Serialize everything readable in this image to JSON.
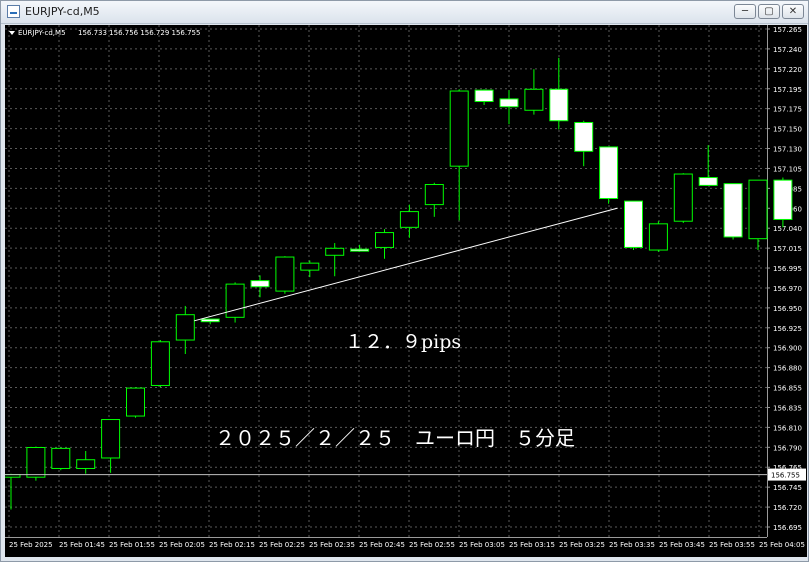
{
  "window": {
    "title": "EURJPY-cd,M5"
  },
  "buttons": {
    "minimize": "─",
    "restore": "▢",
    "close": "✕"
  },
  "header": {
    "symbol": "EURJPY-cd,M5",
    "quotes": "156.733 156.756 156.729 156.755"
  },
  "annotations": {
    "pips": "１２．９pips",
    "caption": "２０２５／２／２５　ユーロ円　５分足"
  },
  "colors": {
    "background": "#000000",
    "grid": "#5a5a5a",
    "bull": "#00ff00",
    "bear_fill": "#ffffff",
    "text": "#ffffff"
  },
  "chart_data": {
    "type": "candlestick",
    "ylim": [
      156.695,
      157.265
    ],
    "yticks": [
      "157.265",
      "157.240",
      "157.220",
      "157.195",
      "157.175",
      "157.150",
      "157.130",
      "157.105",
      "157.085",
      "157.060",
      "157.040",
      "157.015",
      "156.995",
      "156.970",
      "156.950",
      "156.925",
      "156.900",
      "156.880",
      "156.855",
      "156.835",
      "156.810",
      "156.790",
      "156.765",
      "156.745",
      "156.720",
      "156.695"
    ],
    "xticks": [
      "25 Feb 2025",
      "25 Feb 01:45",
      "25 Feb 01:55",
      "25 Feb 02:05",
      "25 Feb 02:15",
      "25 Feb 02:25",
      "25 Feb 02:35",
      "25 Feb 02:45",
      "25 Feb 02:55",
      "25 Feb 03:05",
      "25 Feb 03:15",
      "25 Feb 03:25",
      "25 Feb 03:35",
      "25 Feb 03:45",
      "25 Feb 03:55",
      "25 Feb 04:05"
    ],
    "current_price": "156.755",
    "current_price_value": 156.755,
    "candles": [
      {
        "o": 156.752,
        "h": 156.756,
        "l": 156.715,
        "c": 156.755
      },
      {
        "o": 156.752,
        "h": 156.787,
        "l": 156.748,
        "c": 156.786
      },
      {
        "o": 156.762,
        "h": 156.786,
        "l": 156.76,
        "c": 156.785
      },
      {
        "o": 156.762,
        "h": 156.782,
        "l": 156.756,
        "c": 156.772
      },
      {
        "o": 156.774,
        "h": 156.818,
        "l": 156.757,
        "c": 156.818
      },
      {
        "o": 156.822,
        "h": 156.855,
        "l": 156.82,
        "c": 156.854
      },
      {
        "o": 156.857,
        "h": 156.909,
        "l": 156.855,
        "c": 156.907
      },
      {
        "o": 156.909,
        "h": 156.948,
        "l": 156.893,
        "c": 156.938
      },
      {
        "o": 156.933,
        "h": 156.927,
        "l": 156.927,
        "c": 156.93
      },
      {
        "o": 156.935,
        "h": 156.975,
        "l": 156.929,
        "c": 156.973
      },
      {
        "o": 156.977,
        "h": 156.983,
        "l": 156.958,
        "c": 156.97
      },
      {
        "o": 156.965,
        "h": 157.005,
        "l": 156.962,
        "c": 157.004
      },
      {
        "o": 156.989,
        "h": 157.0,
        "l": 156.981,
        "c": 156.997
      },
      {
        "o": 157.006,
        "h": 157.02,
        "l": 156.982,
        "c": 157.014
      },
      {
        "o": 157.013,
        "h": 157.018,
        "l": 157.01,
        "c": 157.011
      },
      {
        "o": 157.015,
        "h": 157.036,
        "l": 157.002,
        "c": 157.032
      },
      {
        "o": 157.038,
        "h": 157.064,
        "l": 157.026,
        "c": 157.056
      },
      {
        "o": 157.064,
        "h": 157.089,
        "l": 157.05,
        "c": 157.087
      },
      {
        "o": 157.108,
        "h": 157.196,
        "l": 157.046,
        "c": 157.194
      },
      {
        "o": 157.195,
        "h": 157.196,
        "l": 157.178,
        "c": 157.182
      },
      {
        "o": 157.185,
        "h": 157.195,
        "l": 157.156,
        "c": 157.176
      },
      {
        "o": 157.172,
        "h": 157.219,
        "l": 157.167,
        "c": 157.196
      },
      {
        "o": 157.196,
        "h": 157.232,
        "l": 157.15,
        "c": 157.16
      },
      {
        "o": 157.158,
        "h": 157.16,
        "l": 157.108,
        "c": 157.125
      },
      {
        "o": 157.13,
        "h": 157.129,
        "l": 157.065,
        "c": 157.071
      },
      {
        "o": 157.068,
        "h": 157.065,
        "l": 157.012,
        "c": 157.015
      },
      {
        "o": 157.012,
        "h": 157.045,
        "l": 157.01,
        "c": 157.042
      },
      {
        "o": 157.045,
        "h": 157.1,
        "l": 157.043,
        "c": 157.099
      },
      {
        "o": 157.095,
        "h": 157.132,
        "l": 157.088,
        "c": 157.086
      },
      {
        "o": 157.088,
        "h": 157.085,
        "l": 157.024,
        "c": 157.027
      },
      {
        "o": 157.025,
        "h": 157.092,
        "l": 157.012,
        "c": 157.092
      },
      {
        "o": 157.092,
        "h": 157.095,
        "l": 157.038,
        "c": 157.047
      }
    ],
    "trendline": {
      "from": {
        "candle": 7,
        "price": 156.931
      },
      "to": {
        "candle": 24,
        "price": 157.06
      }
    }
  }
}
